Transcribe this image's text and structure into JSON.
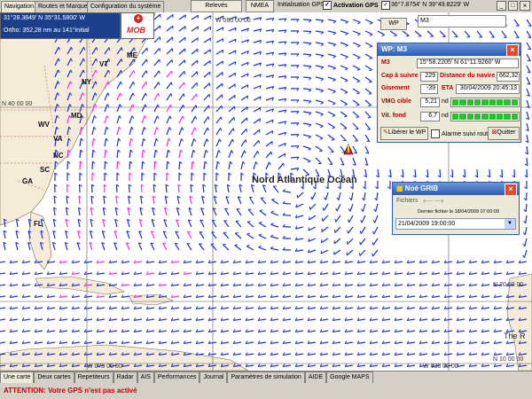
{
  "colors": {
    "accent_title": "#2d5cb4",
    "wind_blue": "#1a2ed8",
    "wind_magenta": "#ff22ff",
    "land": "#f4ecd8",
    "sea": "#ffffff",
    "warning_red": "#cc0000"
  },
  "top_tabs": [
    "Navigation",
    "Routes et Marques",
    "Configuration du système"
  ],
  "toolbar": {
    "releves": "Relevés",
    "nmea": "NMEA",
    "init_gps": "Initialisation GPS",
    "activation_gps": "Activation GPS",
    "gps_coord": "36°7.8754' N 39°49.8229' W"
  },
  "position": {
    "lat_lon": "31°28.3849' N 35°31.5800' W",
    "ortho": "Ortho: 352,28 nm au 141°initial"
  },
  "mob": {
    "label": "MOB"
  },
  "wp_bar": {
    "wp_label": "WP",
    "wp_name": "M3"
  },
  "map": {
    "coords": {
      "top_lon": "W 060 00 00",
      "lat40": "N 40 00 00",
      "lat20": "N 20 00 00",
      "lat10": "N 10 00 00",
      "bottom_lon_left": "W 075 00 00",
      "bottom_lon_right": "W 030 00 00"
    },
    "states": [
      "ME",
      "VT",
      "NY",
      "MD",
      "WV",
      "VA",
      "NC",
      "SC",
      "GA",
      "FL"
    ],
    "ocean_label": "Nord Atlantique Océan",
    "island_label": "The R"
  },
  "wp_window": {
    "title": "WP: M3",
    "name": "M3",
    "coord": "15°58.2205' N 61°11.9260' W",
    "cap_label": "Cap à suivre",
    "cap_value": "229",
    "dist_label": "Distance du navire",
    "dist_value": "662,32",
    "gisement_label": "Gisement",
    "gisement_value": "-39",
    "eta_label": "ETA",
    "eta_value": "30/04/2009 20:45:13",
    "vmg_label": "VMG cible",
    "vmg_value": "5,21",
    "vmg_unit": "nd",
    "vit_label": "Vit. fond",
    "vit_value": "6,7",
    "vit_unit": "nd",
    "release_btn": "Libérer le WP",
    "alarm_label": "Alarme suivi route",
    "quit_btn": "Quitter"
  },
  "grib_window": {
    "title": "Noé GRIB",
    "menu_files": "Fichiers",
    "last_file": "Dernier fichier le 18/04/2009 07:00:00",
    "date_selected": "21/04/2009 19:00:00"
  },
  "bottom_tabs": [
    "Une carte",
    "Deux cartes",
    "Repetiteurs",
    "Radar",
    "AIS",
    "Performances",
    "Journal",
    "Paramètres de simulation",
    "AIDE",
    "Google MAPS"
  ],
  "status": {
    "warning": "ATTENTION: Votre GPS n'est pas activé"
  }
}
